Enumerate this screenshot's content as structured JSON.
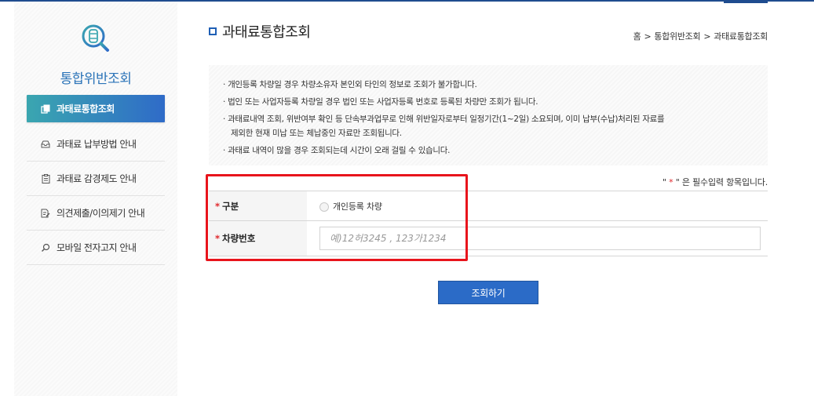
{
  "colors": {
    "accent": "#2b6bc7",
    "brand_dark": "#1f4c8f",
    "active_gradient_start": "#3aa6b0",
    "active_gradient_end": "#2f6bc8",
    "required": "#e0262a",
    "highlight_box": "#e8141c"
  },
  "sidebar": {
    "logo_icon": "car-search-icon",
    "title": "통합위반조회",
    "items": [
      {
        "label": "과태료통합조회",
        "icon": "document-stack-icon",
        "active": true
      },
      {
        "label": "과태료 납부방법 안내",
        "icon": "tray-icon",
        "active": false
      },
      {
        "label": "과태료 감경제도 안내",
        "icon": "clipboard-icon",
        "active": false
      },
      {
        "label": "의견제출/이의제기 안내",
        "icon": "edit-document-icon",
        "active": false
      },
      {
        "label": "모바일 전자고지 안내",
        "icon": "search-icon",
        "active": false
      }
    ]
  },
  "header": {
    "title": "과태료통합조회",
    "breadcrumb": [
      "홈",
      "통합위반조회",
      "과태료통합조회"
    ],
    "breadcrumb_separator": ">"
  },
  "notice": {
    "lines": [
      "· 개인등록 차량일 경우 차량소유자 본인외 타인의 정보로 조회가 불가합니다.",
      "· 법인 또는 사업자등록 차량일 경우 법인 또는 사업자등록 번호로 등록된 차량만 조회가 됩니다.",
      "· 과태료내역 조회, 위반여부 확인 등 단속부과업무로 인해 위반일자로부터 일정기간(1~2일) 소요되며, 이미 납부(수납)처리된 자료를",
      "제외한 현재 미납 또는 체납중인 자료만 조회됩니다.",
      "· 과태료 내역이 많을 경우 조회되는데 시간이 오래 걸릴 수 있습니다."
    ]
  },
  "required_note": {
    "prefix": "\" ",
    "star": "*",
    "suffix": " \" 은 필수입력 항목입니다."
  },
  "form": {
    "category": {
      "star": "*",
      "label": "구분",
      "option_label": "개인등록 차량"
    },
    "plate": {
      "star": "*",
      "label": "차량번호",
      "placeholder": "예)12허3245 , 123가1234",
      "value": ""
    }
  },
  "actions": {
    "search_label": "조회하기"
  }
}
